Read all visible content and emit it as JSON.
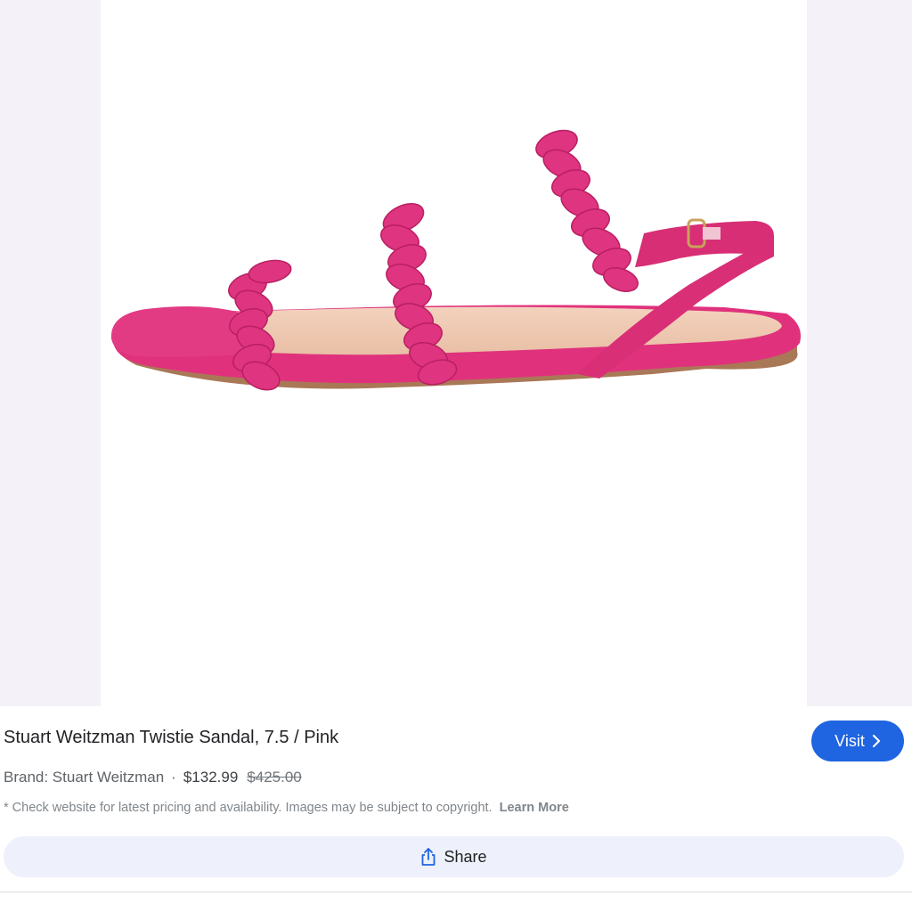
{
  "product": {
    "title": "Stuart Weitzman Twistie Sandal, 7.5 / Pink",
    "brand_text": "Brand: Stuart Weitzman",
    "separator": "·",
    "price": "$132.99",
    "original_price": "$425.00",
    "image_icon": "pink-braided-sandal-photo"
  },
  "actions": {
    "visit_label": "Visit",
    "visit_icon": "chevron-right-icon",
    "share_label": "Share",
    "share_icon": "share-icon"
  },
  "disclaimer": {
    "text": "* Check website for latest pricing and availability. Images may be subject to copyright.",
    "learn_more": "Learn More"
  },
  "colors": {
    "accent": "#1f64e0",
    "sandal_pink": "#e0327c",
    "share_bg": "#eef0fb",
    "image_bg": "#f5f1f8"
  }
}
